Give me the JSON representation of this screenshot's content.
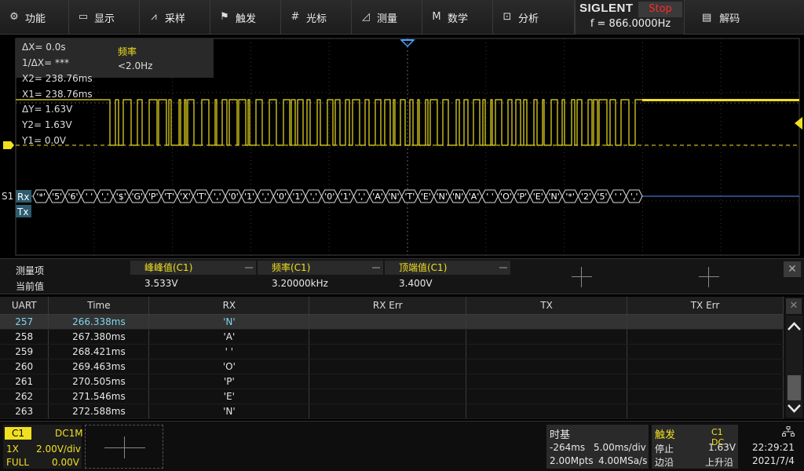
{
  "menu": [
    {
      "label": "功能",
      "icon": "gear-icon"
    },
    {
      "label": "显示",
      "icon": "monitor-icon"
    },
    {
      "label": "采样",
      "icon": "sample-icon"
    },
    {
      "label": "触发",
      "icon": "flag-icon"
    },
    {
      "label": "光标",
      "icon": "cursor-icon"
    },
    {
      "label": "测量",
      "icon": "measure-icon"
    },
    {
      "label": "数学",
      "icon": "math-icon"
    },
    {
      "label": "分析",
      "icon": "analyze-icon"
    }
  ],
  "brand": {
    "logo": "SIGLENT",
    "status": "Stop",
    "freq": "f = 866.0000Hz"
  },
  "decode_menu": {
    "label": "解码",
    "icon": "decode-icon"
  },
  "cursor": {
    "dx": "ΔX= 0.0s",
    "inv_dx": "1/ΔX= ***",
    "x2": "X2= 238.76ms",
    "x1": "X1= 238.76ms",
    "dy": "ΔY= 1.63V",
    "y2": "Y2= 1.63V",
    "y1": "Y1= 0.0V",
    "freq_label": "频率",
    "freq_value": "<2.0Hz"
  },
  "decode_bus": {
    "label": "S1",
    "rx_label": "Rx",
    "tx_label": "Tx",
    "rx_frames": [
      "'*'",
      "'5'",
      "'6'",
      "' '",
      "','",
      "'$'",
      "'G'",
      "'P'",
      "'T'",
      "'X'",
      "'T'",
      "','",
      "'0'",
      "'1'",
      "','",
      "'0'",
      "'1'",
      "','",
      "'0'",
      "'1'",
      "','",
      "'A'",
      "'N'",
      "'T'",
      "'E'",
      "'N'",
      "'N'",
      "'A'",
      "' '",
      "'O'",
      "'P'",
      "'E'",
      "'N'",
      "'*'",
      "'2'",
      "'5'",
      "' '",
      "','"
    ]
  },
  "markers": {
    "trigger_left": "T",
    "ch1_ground": "1"
  },
  "measure": {
    "row1_label": "测量项",
    "row2_label": "当前值",
    "items": [
      {
        "name": "峰峰值(C1)",
        "value": "3.533V"
      },
      {
        "name": "频率(C1)",
        "value": "3.20000kHz"
      },
      {
        "name": "顶端值(C1)",
        "value": "3.400V"
      }
    ]
  },
  "decode_table": {
    "headers": [
      "UART",
      "Time",
      "RX",
      "RX Err",
      "TX",
      "TX Err"
    ],
    "rows": [
      [
        "257",
        "266.338ms",
        "'N'",
        "",
        "",
        ""
      ],
      [
        "258",
        "267.380ms",
        "'A'",
        "",
        "",
        ""
      ],
      [
        "259",
        "268.421ms",
        "' '",
        "",
        "",
        ""
      ],
      [
        "260",
        "269.463ms",
        "'O'",
        "",
        "",
        ""
      ],
      [
        "261",
        "270.505ms",
        "'P'",
        "",
        "",
        ""
      ],
      [
        "262",
        "271.546ms",
        "'E'",
        "",
        "",
        ""
      ],
      [
        "263",
        "272.588ms",
        "'N'",
        "",
        "",
        ""
      ]
    ],
    "selected_index": 0
  },
  "channel1": {
    "tag": "C1",
    "coupling": "DC1M",
    "probe": "1X",
    "scale": "2.00V/div",
    "bw": "FULL",
    "offset": "0.00V"
  },
  "timebase": {
    "title": "时基",
    "delay": "-264ms",
    "scale": "5.00ms/div",
    "points": "2.00Mpts",
    "rate": "4.00MSa/s"
  },
  "trigger": {
    "title": "触发",
    "source": "C1 DC",
    "state": "停止",
    "level": "1.63V",
    "type": "边沿",
    "slope": "上升沿"
  },
  "clock": {
    "time": "22:29:21",
    "date": "2021/7/4"
  },
  "colors": {
    "ch1": "#f0e020",
    "bus": "#4a90ff",
    "status_stop": "#ff2a2a",
    "selected_row": "#7fd6f0"
  }
}
